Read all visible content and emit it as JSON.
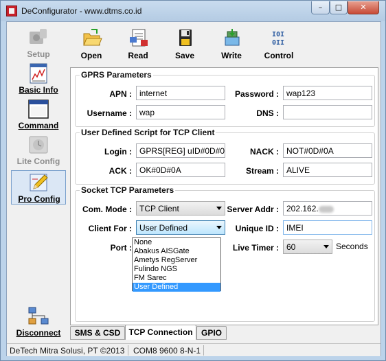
{
  "window": {
    "title": "DeConfigurator - www.dtms.co.id"
  },
  "title_controls": {
    "minimize": "–",
    "maximize": "□",
    "close": "✕"
  },
  "sidebar": {
    "items": [
      {
        "label": "Setup",
        "icon": "gear-setup-icon",
        "enabled": false
      },
      {
        "label": "Basic Info",
        "icon": "chart-info-icon",
        "enabled": true
      },
      {
        "label": "Command",
        "icon": "window-command-icon",
        "enabled": true
      },
      {
        "label": "Lite Config",
        "icon": "clock-config-icon",
        "enabled": false
      },
      {
        "label": "Pro Config",
        "icon": "pencil-config-icon",
        "enabled": true,
        "active": true
      },
      {
        "label": "Disconnect",
        "icon": "network-disconnect-icon",
        "enabled": true
      }
    ]
  },
  "toolbar": {
    "open": "Open",
    "read": "Read",
    "save": "Save",
    "write": "Write",
    "control": "Control"
  },
  "gprs": {
    "title": "GPRS Parameters",
    "apn_label": "APN :",
    "apn_value": "internet",
    "password_label": "Password :",
    "password_value": "wap123",
    "username_label": "Username :",
    "username_value": "wap",
    "dns_label": "DNS :",
    "dns_value": ""
  },
  "script": {
    "title": "User Defined Script for TCP Client",
    "login_label": "Login :",
    "login_value": "GPRS[REG] uID#0D#0A",
    "nack_label": "NACK :",
    "nack_value": "NOT#0D#0A",
    "ack_label": "ACK :",
    "ack_value": "OK#0D#0A",
    "stream_label": "Stream :",
    "stream_value": "ALIVE"
  },
  "socket": {
    "title": "Socket TCP Parameters",
    "com_mode_label": "Com. Mode :",
    "com_mode_value": "TCP Client",
    "server_addr_label": "Server Addr :",
    "server_addr_value": "202.162.",
    "client_for_label": "Client For :",
    "client_for_value": "User Defined",
    "unique_id_label": "Unique ID :",
    "unique_id_value": "IMEI",
    "port_label": "Port :",
    "live_timer_label": "Live Timer :",
    "live_timer_value": "60",
    "live_timer_unit": "Seconds",
    "client_for_options": [
      "None",
      "Abakus AISGate",
      "Ametys RegServer",
      "Fulindo NGS",
      "FM Sarec",
      "User Defined"
    ]
  },
  "tabs": [
    "SMS & CSD",
    "TCP Connection",
    "GPIO"
  ],
  "status": {
    "company": "DeTech Mitra Solusi, PT ©2013",
    "port": "COM8 9600 8-N-1"
  },
  "colors": {
    "window_frame": "#bcd3ea",
    "selected": "#3399ff",
    "close_button": "#c74a36"
  }
}
